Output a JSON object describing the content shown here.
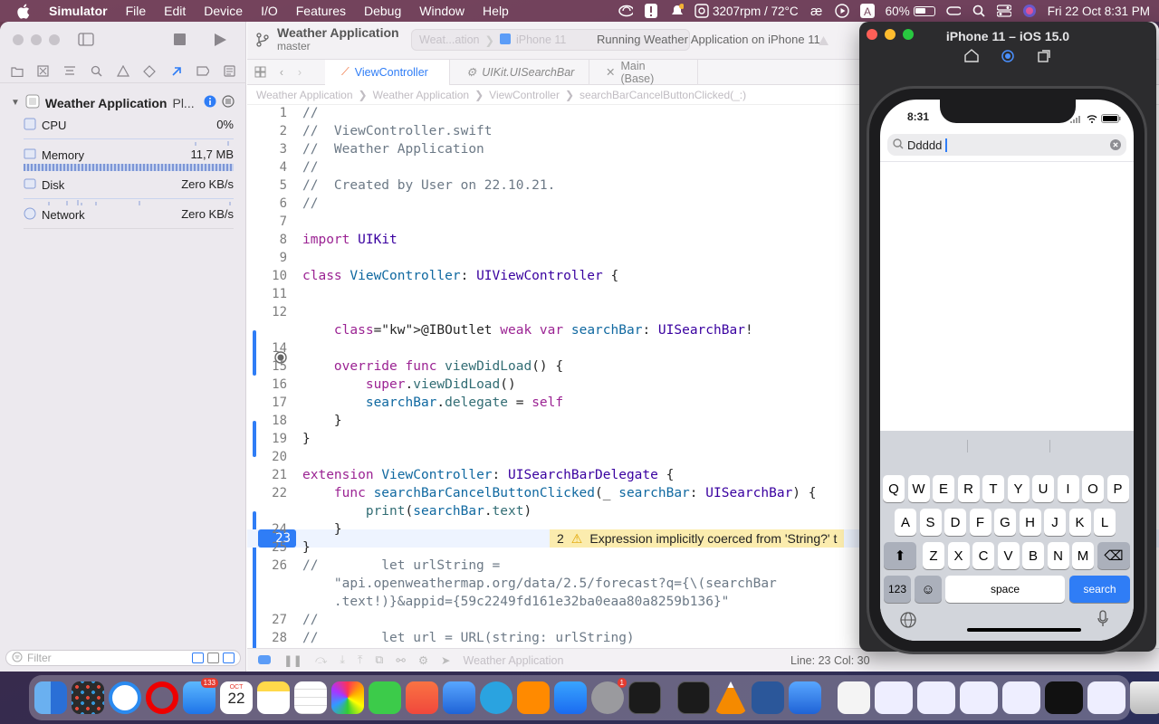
{
  "menubar": {
    "app_name": "Simulator",
    "items": [
      "File",
      "Edit",
      "Device",
      "I/O",
      "Features",
      "Debug",
      "Window",
      "Help"
    ],
    "fan_status": "3207rpm / 72°C",
    "battery_percent": "60%",
    "battery_level": 0.6,
    "datetime": "Fri 22 Oct  8:31 PM"
  },
  "xcode": {
    "scheme_title": "Weather Application",
    "branch": "master",
    "scheme_pill": "Weat...ation",
    "device_pill": "iPhone 11",
    "status": "Running Weather Application on iPhone 11",
    "tabs": [
      "ViewController",
      "UIKit.UISearchBar",
      "Main (Base)"
    ],
    "breadcrumb": [
      "Weather Application",
      "Weather Application",
      "ViewController",
      "searchBarCancelButtonClicked(_:)"
    ],
    "navigator": {
      "project_name": "Weather Application",
      "project_suffix": "Pl...",
      "rows": [
        {
          "label": "CPU",
          "value": "0%"
        },
        {
          "label": "Memory",
          "value": "11,7 MB"
        },
        {
          "label": "Disk",
          "value": "Zero KB/s"
        },
        {
          "label": "Network",
          "value": "Zero KB/s"
        }
      ],
      "filter_placeholder": "Filter"
    },
    "editor": {
      "current_line": "23",
      "warning_count": "2",
      "warning_text": "Expression implicitly coerced from 'String?' t"
    },
    "debug_bar": {
      "target": "Weather Application",
      "position": "Line: 23  Col: 30"
    }
  },
  "code_lines": [
    {
      "n": "1",
      "t": "//"
    },
    {
      "n": "2",
      "t": "//  ViewController.swift"
    },
    {
      "n": "3",
      "t": "//  Weather Application"
    },
    {
      "n": "4",
      "t": "//"
    },
    {
      "n": "5",
      "t": "//  Created by User on 22.10.21."
    },
    {
      "n": "6",
      "t": "//"
    },
    {
      "n": "7",
      "t": ""
    },
    {
      "n": "8",
      "t": "import UIKit"
    },
    {
      "n": "9",
      "t": ""
    },
    {
      "n": "10",
      "t": "class ViewController: UIViewController {"
    },
    {
      "n": "11",
      "t": ""
    },
    {
      "n": "12",
      "t": ""
    },
    {
      "n": "",
      "t": "    @IBOutlet weak var searchBar: UISearchBar!"
    },
    {
      "n": "14",
      "t": ""
    },
    {
      "n": "15",
      "t": "    override func viewDidLoad() {"
    },
    {
      "n": "16",
      "t": "        super.viewDidLoad()"
    },
    {
      "n": "17",
      "t": "        searchBar.delegate = self"
    },
    {
      "n": "18",
      "t": "    }"
    },
    {
      "n": "19",
      "t": "}"
    },
    {
      "n": "20",
      "t": ""
    },
    {
      "n": "21",
      "t": "extension ViewController: UISearchBarDelegate {"
    },
    {
      "n": "22",
      "t": "    func searchBarCancelButtonClicked(_ searchBar: UISearchBar) {"
    },
    {
      "n": "23",
      "t": "        print(searchBar.text)"
    },
    {
      "n": "24",
      "t": "    }"
    },
    {
      "n": "25",
      "t": "}"
    },
    {
      "n": "26",
      "t": "//        let urlString ="
    },
    {
      "n": "",
      "t": "    \"api.openweathermap.org/data/2.5/forecast?q={\\(searchBar"
    },
    {
      "n": "",
      "t": "    .text!)}&appid={59c2249fd161e32ba0eaa80a8259b136}\""
    },
    {
      "n": "27",
      "t": "//"
    },
    {
      "n": "28",
      "t": "//        let url = URL(string: urlString)"
    }
  ],
  "simulator": {
    "title": "iPhone 11 – iOS 15.0",
    "time": "8:31",
    "search_text": "Ddddd",
    "keys_row1": [
      "Q",
      "W",
      "E",
      "R",
      "T",
      "Y",
      "U",
      "I",
      "O",
      "P"
    ],
    "keys_row2": [
      "A",
      "S",
      "D",
      "F",
      "G",
      "H",
      "J",
      "K",
      "L"
    ],
    "keys_row3": [
      "Z",
      "X",
      "C",
      "V",
      "B",
      "N",
      "M"
    ],
    "key_numbers": "123",
    "key_space": "space",
    "key_search": "search"
  },
  "dock": {
    "mail_badge": "133",
    "calendar_month": "OCT",
    "calendar_day": "22",
    "settings_badge": "1"
  }
}
